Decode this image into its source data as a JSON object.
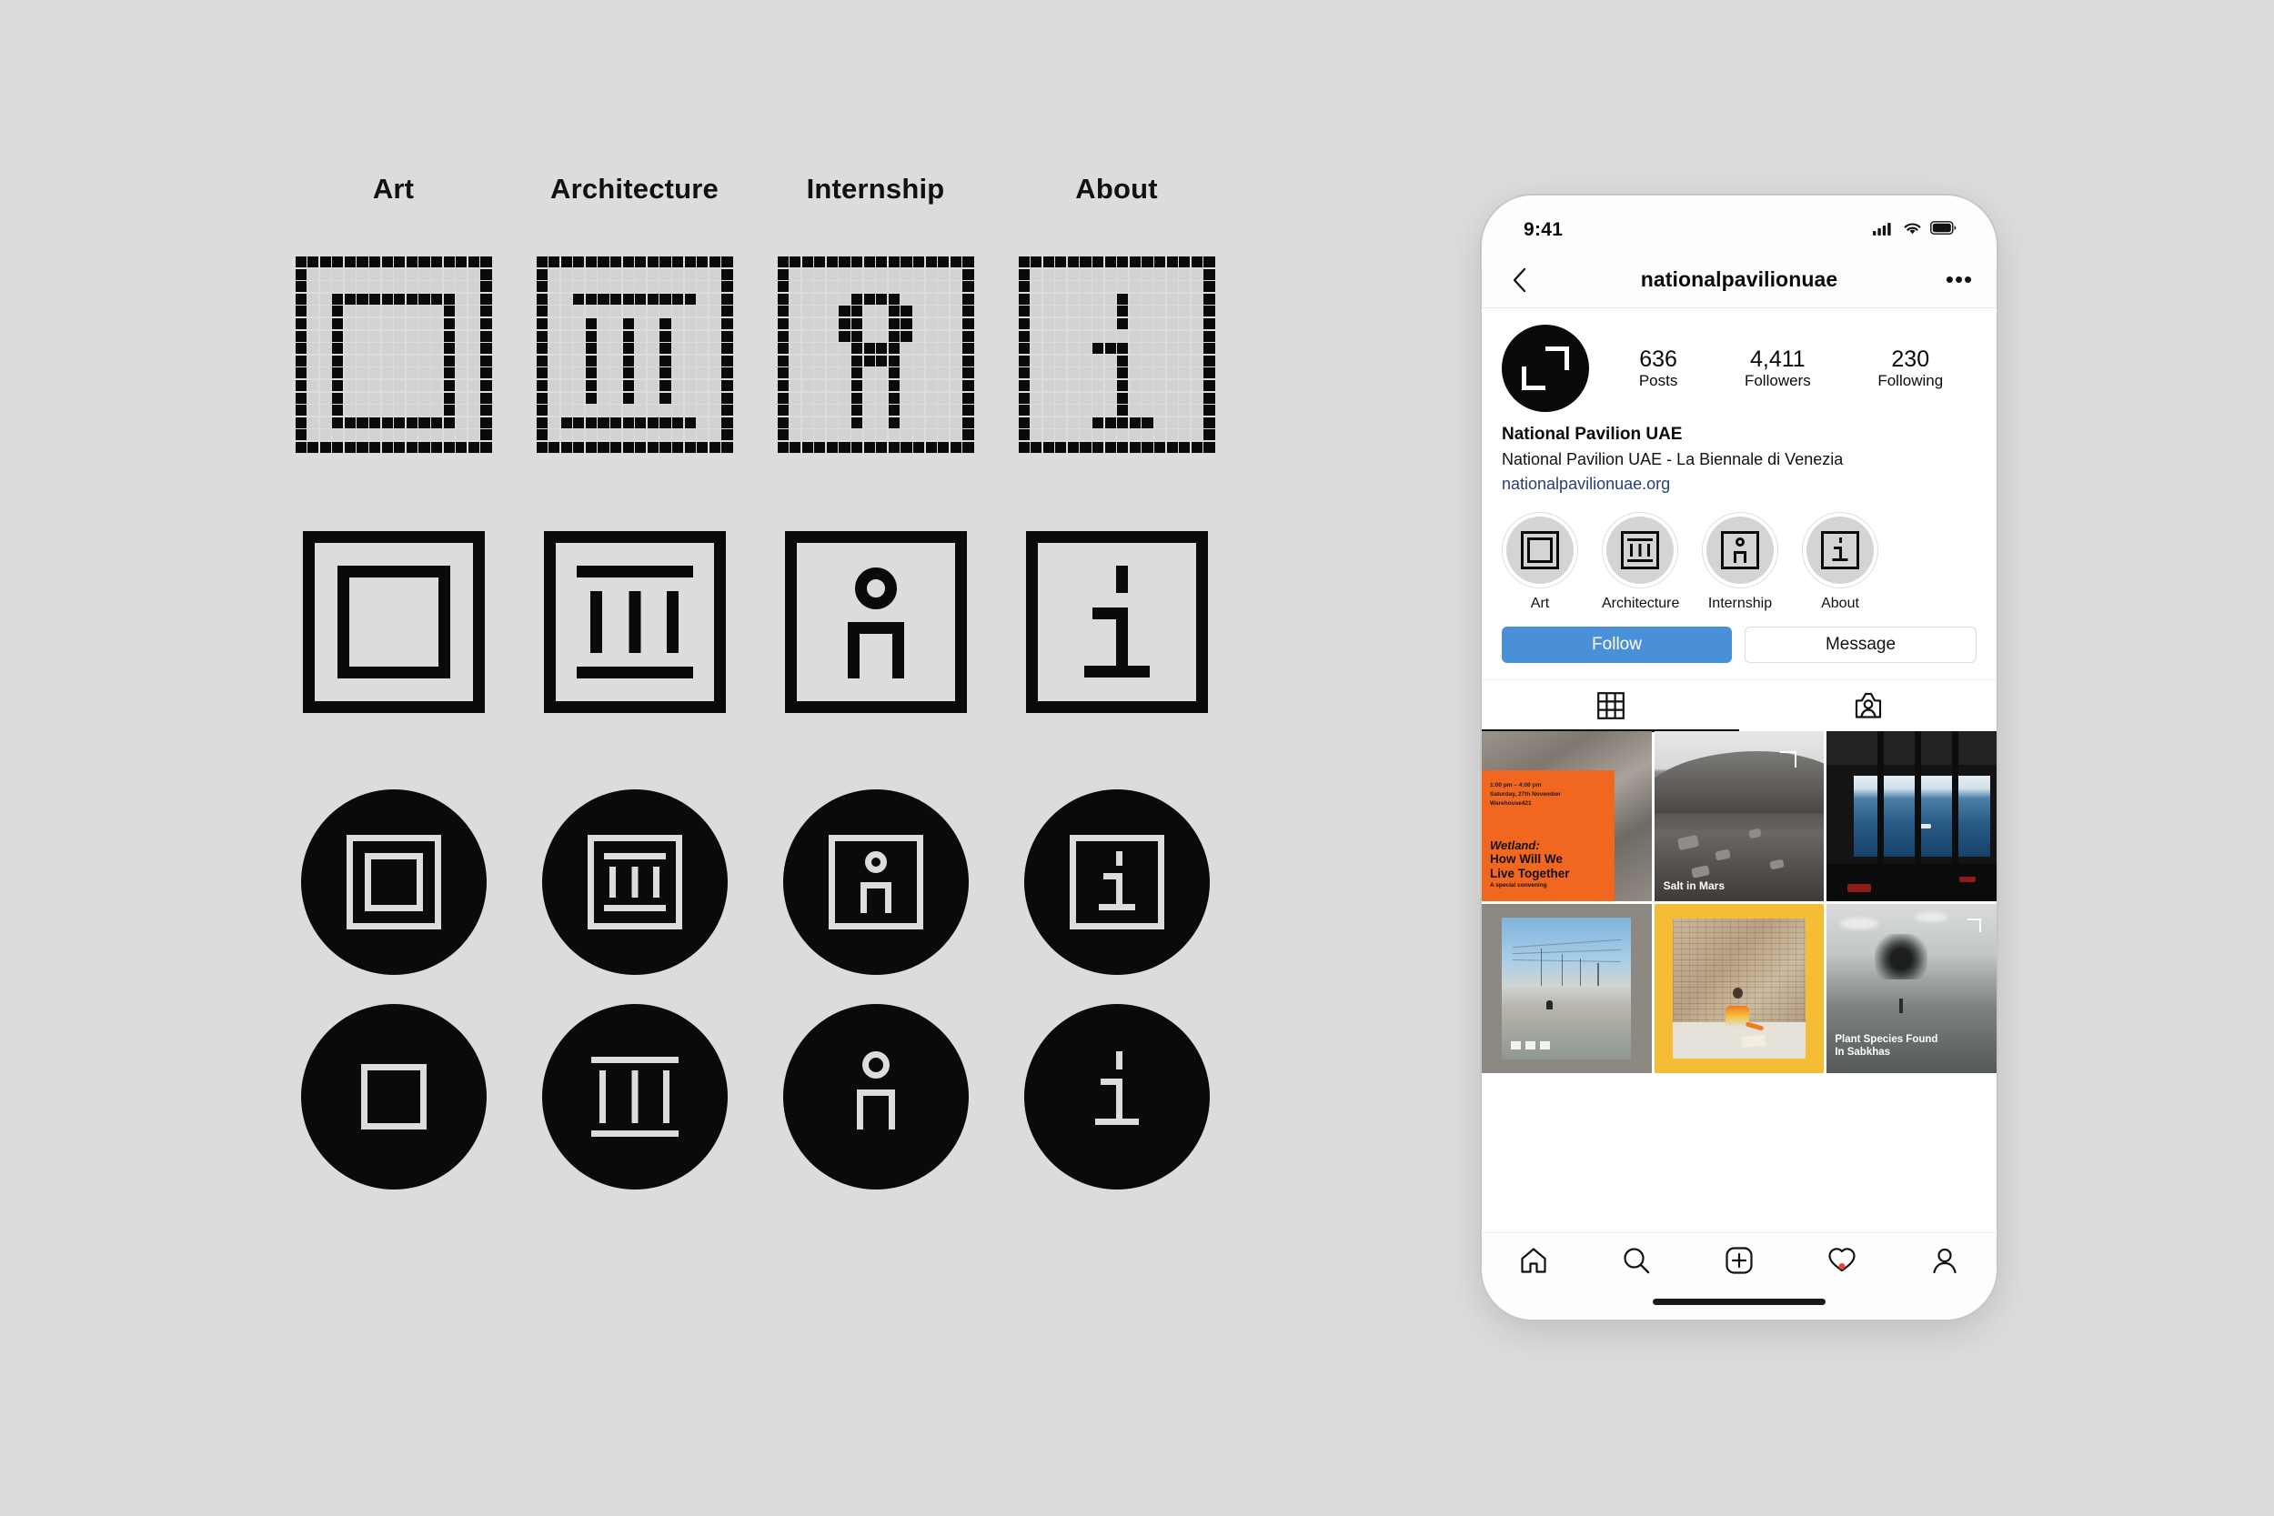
{
  "board": {
    "columns": [
      {
        "label": "Art",
        "icon": "framed-square-icon"
      },
      {
        "label": "Architecture",
        "icon": "classical-columns-icon"
      },
      {
        "label": "Internship",
        "icon": "person-figure-icon"
      },
      {
        "label": "About",
        "icon": "information-i-icon"
      }
    ]
  },
  "phone": {
    "status": {
      "time": "9:41",
      "cellular": "signal-bars-icon",
      "wifi": "wifi-icon",
      "battery": "battery-full-icon"
    },
    "nav": {
      "back": "back-chevron-icon",
      "title": "nationalpavilionuae",
      "more": "more-options-icon"
    },
    "profile": {
      "avatar_icon": "corner-brackets-logo",
      "stats": [
        {
          "value": "636",
          "label": "Posts"
        },
        {
          "value": "4,411",
          "label": "Followers"
        },
        {
          "value": "230",
          "label": "Following"
        }
      ],
      "name": "National Pavilion UAE",
      "description": "National Pavilion UAE - La Biennale di Venezia",
      "link": "nationalpavilionuae.org"
    },
    "highlights": [
      {
        "label": "Art",
        "icon": "framed-square-icon"
      },
      {
        "label": "Architecture",
        "icon": "classical-columns-icon"
      },
      {
        "label": "Internship",
        "icon": "person-figure-icon"
      },
      {
        "label": "About",
        "icon": "information-i-icon"
      }
    ],
    "actions": {
      "follow": "Follow",
      "message": "Message"
    },
    "tabs": [
      {
        "icon": "grid-tab-icon",
        "active": true
      },
      {
        "icon": "tagged-tab-icon",
        "active": false
      }
    ],
    "posts": [
      {
        "id": "wetland-convening",
        "meta_line1": "1:00 pm – 4:00 pm",
        "meta_line2": "Saturday, 27th November",
        "meta_line3": "Warehouse421",
        "title_italic": "Wetland:",
        "title_line1": "How Will We",
        "title_line2": "Live Together",
        "subtitle": "A special convening"
      },
      {
        "id": "salt-in-mars",
        "caption": "Salt in Mars"
      },
      {
        "id": "gallery-sea-installation",
        "caption": ""
      },
      {
        "id": "salt-flats-pylons",
        "caption": ""
      },
      {
        "id": "archive-research-table",
        "caption": ""
      },
      {
        "id": "plant-species-sabkhas",
        "caption_line1": "Plant Species Found",
        "caption_line2": "In Sabkhas"
      }
    ],
    "tabbar": [
      {
        "icon": "home-icon",
        "badge": false
      },
      {
        "icon": "search-icon",
        "badge": false
      },
      {
        "icon": "add-post-icon",
        "badge": false
      },
      {
        "icon": "heart-icon",
        "badge": true
      },
      {
        "icon": "profile-icon",
        "badge": false
      }
    ]
  },
  "colors": {
    "background": "#dcdcdc",
    "ink": "#0a0a0a",
    "follow_blue": "#4a90d9",
    "link_blue": "#27407a",
    "poster_orange": "#f2671f",
    "frame_yellow": "#f5bc35",
    "badge_red": "#e8453c"
  }
}
